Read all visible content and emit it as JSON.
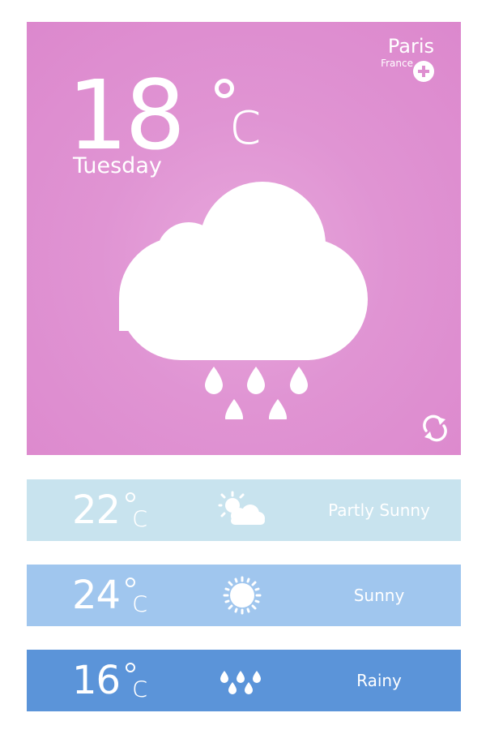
{
  "current": {
    "temperature": "18",
    "unit": "c",
    "day": "Tuesday",
    "city": "Paris",
    "country": "France",
    "condition_icon": "cloud-rain-icon",
    "background_color": "#e094d3"
  },
  "forecast": [
    {
      "temperature": "22",
      "unit": "c",
      "label": "Partly Sunny",
      "icon": "partly-sunny-icon",
      "color": "#c8e3ee"
    },
    {
      "temperature": "24",
      "unit": "c",
      "label": "Sunny",
      "icon": "sun-icon",
      "color": "#a0c6ee"
    },
    {
      "temperature": "16",
      "unit": "c",
      "label": "Rainy",
      "icon": "rain-icon",
      "color": "#5b94d9"
    }
  ]
}
